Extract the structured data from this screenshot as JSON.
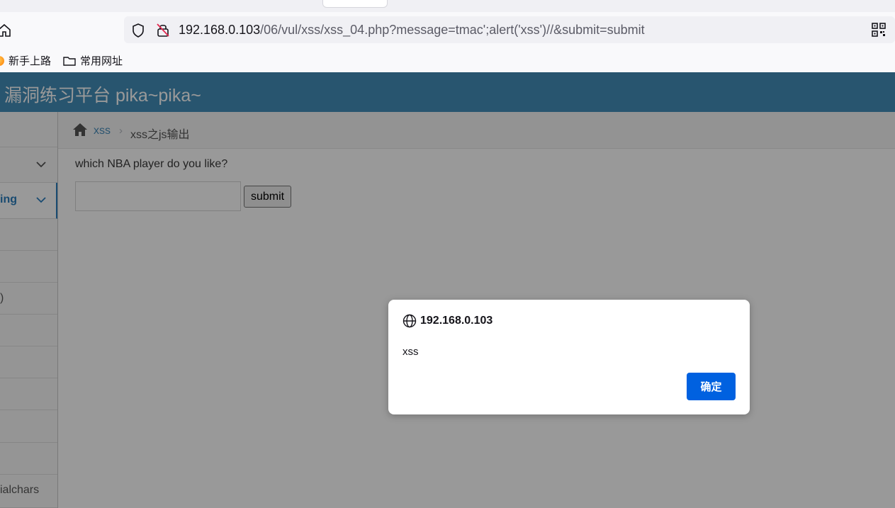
{
  "browser": {
    "url_host": "192.168.0.103",
    "url_path": "/06/vul/xss/xss_04.php?message=tmac';alert('xss')//&submit=submit",
    "bookmarks": [
      "新手上路",
      "常用网址"
    ]
  },
  "site": {
    "title": "漏洞练习平台 pika~pika~"
  },
  "sidebar": {
    "items": [
      "ing",
      ")",
      "ialchars"
    ]
  },
  "breadcrumb": {
    "parent": "xss",
    "separator": "›",
    "current": "xss之js输出"
  },
  "form": {
    "question": "which NBA player do you like?",
    "input_value": "",
    "submit_label": "submit"
  },
  "dialog": {
    "origin": "192.168.0.103",
    "message": "xss",
    "ok_label": "确定"
  },
  "colors": {
    "header": "#438eb9",
    "dialog_button": "#0061e0",
    "link": "#4c8fbd"
  }
}
